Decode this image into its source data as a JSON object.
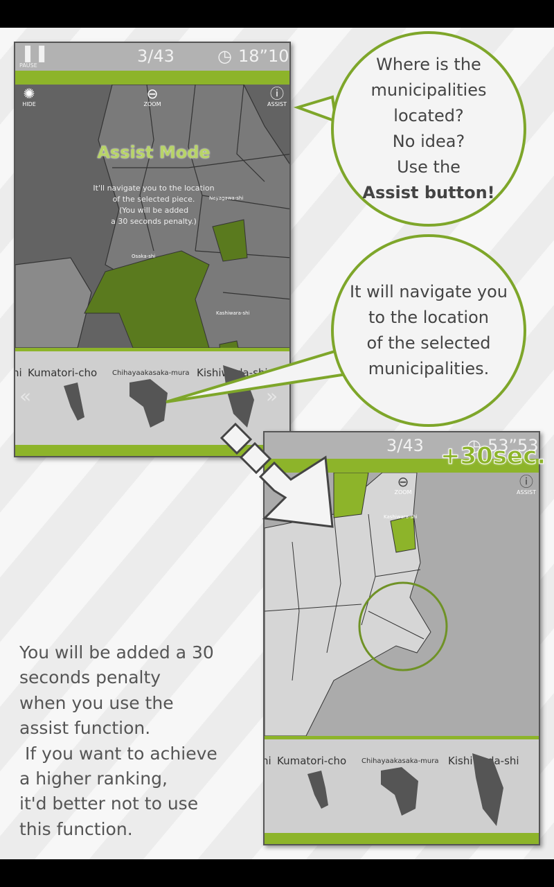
{
  "screen1": {
    "pause_label": "PAUSE",
    "progress": "3/43",
    "timer": "18”10",
    "hide_label": "HIDE",
    "zoom_label": "ZOOM",
    "assist_label": "ASSIST",
    "overlay_title": "Assist Mode",
    "overlay_lines": [
      "It'll navigate you to the location",
      "of the selected piece.",
      "(You will be added",
      "a 30 seconds penalty.)"
    ],
    "map_labels": [
      "Neyagawa-shi",
      "Osaka-shi",
      "Kashiwara-shi"
    ],
    "pieces": [
      "hi",
      "Kumatori-cho",
      "Chihayaakasaka-mura",
      "Kishiwada-shi"
    ],
    "left_arrow": "«",
    "right_arrow": "»"
  },
  "bubble1": {
    "lines": [
      "Where is the",
      "municipalities",
      "located?",
      "No idea?",
      "Use the"
    ],
    "bold": "Assist button!"
  },
  "bubble2": {
    "lines": [
      "It will navigate you",
      "to the location",
      "of the selected",
      "municipalities."
    ]
  },
  "screen2": {
    "progress": "3/43",
    "timer": "53”53",
    "penalty": "+30sec.",
    "zoom_label": "ZOOM",
    "assist_label": "ASSIST",
    "map_label": "Kashiwara-shi",
    "pieces": [
      "hi",
      "Kumatori-cho",
      "Chihayaakasaka-mura",
      "Kishiwada-shi"
    ]
  },
  "caption": [
    "You will be added a 30",
    "seconds penalty",
    "when you use the",
    "assist function.",
    " If you want to achieve",
    "a higher ranking,",
    "it'd better not to use",
    "this function."
  ],
  "colors": {
    "accent": "#8db42a",
    "highlight": "#5a7a1e"
  }
}
